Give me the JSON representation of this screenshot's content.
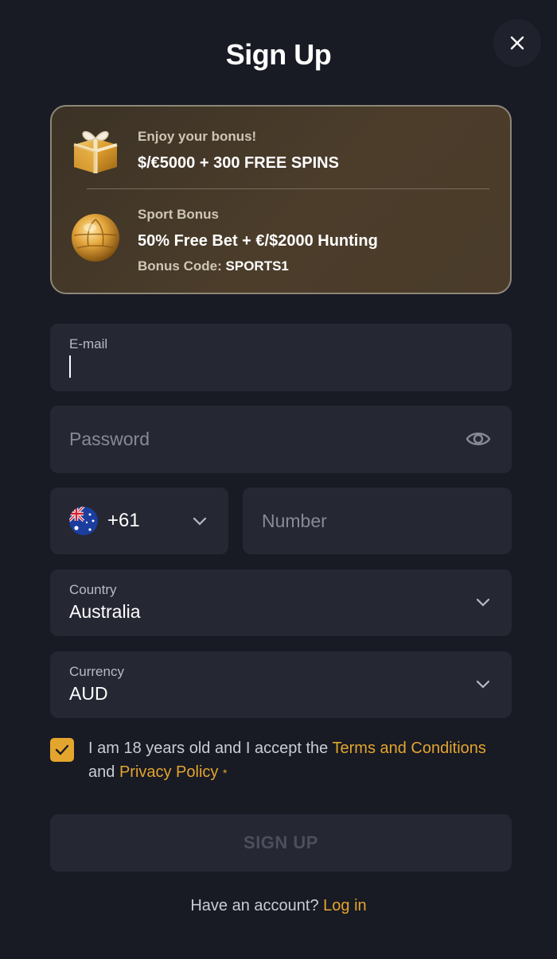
{
  "page": {
    "title": "Sign Up"
  },
  "bonus": {
    "casino": {
      "subtitle": "Enjoy your bonus!",
      "offer": "$/€5000 + 300 FREE SPINS",
      "icon": "gift-box-icon"
    },
    "sport": {
      "subtitle": "Sport Bonus",
      "offer": "50% Free Bet + €/$2000 Hunting",
      "code_label": "Bonus Code:",
      "code_value": "SPORTS1",
      "icon": "gold-football-icon"
    }
  },
  "form": {
    "email": {
      "label": "E-mail",
      "value": ""
    },
    "password": {
      "placeholder": "Password"
    },
    "phone": {
      "dial_code": "+61",
      "flag": "australia-flag-icon",
      "number_placeholder": "Number"
    },
    "country": {
      "label": "Country",
      "value": "Australia"
    },
    "currency": {
      "label": "Currency",
      "value": "AUD"
    },
    "consent": {
      "checked": true,
      "text_before": "I am 18 years old and I accept the",
      "terms_link": "Terms and Conditions",
      "text_and": "and",
      "privacy_link": "Privacy Policy",
      "required_mark": "*"
    },
    "submit_label": "SIGN UP"
  },
  "footer": {
    "prompt": "Have an account?",
    "login_link": "Log in"
  },
  "colors": {
    "background": "#181a24",
    "field": "#252733",
    "accent": "#e3a52d",
    "card_border": "#8d8778"
  }
}
